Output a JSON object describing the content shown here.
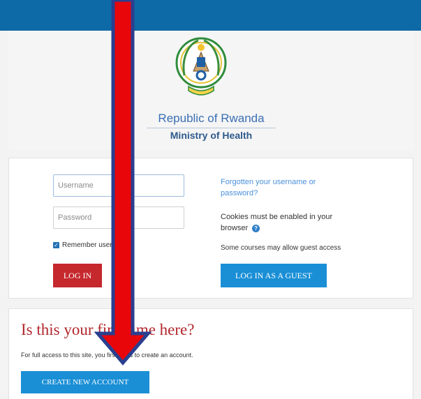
{
  "header": {
    "country": "Republic of Rwanda",
    "ministry": "Ministry of Health"
  },
  "login": {
    "username_placeholder": "Username",
    "password_placeholder": "Password",
    "remember_label": "Remember username",
    "remember_checked": true,
    "login_button": "LOG IN"
  },
  "side": {
    "forgot_link": "Forgotten your username or password?",
    "cookies_text": "Cookies must be enabled in your browser",
    "guest_note": "Some courses may allow guest access",
    "guest_button": "LOG IN AS A GUEST"
  },
  "signup": {
    "title": "Is this your first time here?",
    "text": "For full access to this site, you first need to create an account.",
    "create_button": "CREATE NEW ACCOUNT"
  },
  "colors": {
    "topbar": "#0e6aa6",
    "login_button": "#c5282d",
    "primary_button": "#1a8fd6",
    "arrow_fill": "#e8060b",
    "arrow_outline": "#2a3f8f"
  },
  "icons": {
    "emblem": "rwanda-coat-of-arms-icon",
    "help": "help-circle-icon",
    "checkbox": "check-icon",
    "overlay": "down-arrow-icon"
  }
}
